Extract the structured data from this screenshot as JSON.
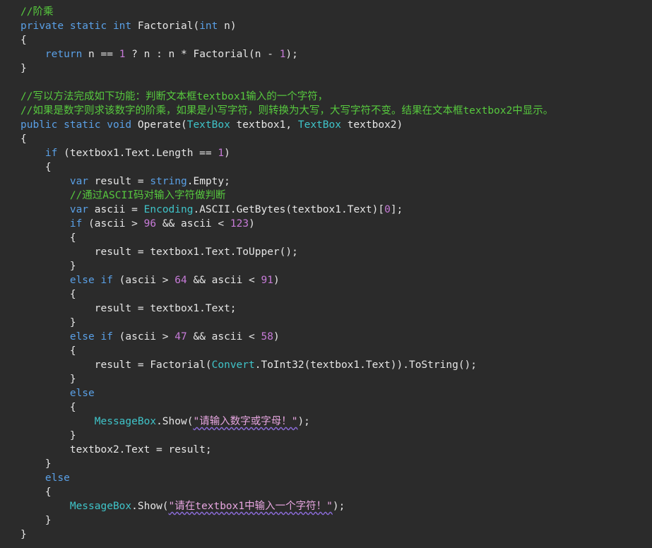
{
  "editor": {
    "background": "#2b2b2b",
    "colors": {
      "keyword": "#5aa0e6",
      "plain": "#e6e6e6",
      "comment": "#57c93e",
      "number": "#c77bd8",
      "type": "#3fc4c9",
      "string": "#e7a6e0"
    },
    "lines": [
      [
        [
          "cm",
          "//阶乘"
        ]
      ],
      [
        [
          "kw",
          "private static int "
        ],
        [
          "pl",
          "Factorial("
        ],
        [
          "kw",
          "int"
        ],
        [
          "pl",
          " n)"
        ]
      ],
      [
        [
          "pl",
          "{"
        ]
      ],
      [
        [
          "pl",
          "    "
        ],
        [
          "kw",
          "return"
        ],
        [
          "pl",
          " n == "
        ],
        [
          "num",
          "1"
        ],
        [
          "pl",
          " ? n : n * Factorial(n - "
        ],
        [
          "num",
          "1"
        ],
        [
          "pl",
          ");"
        ]
      ],
      [
        [
          "pl",
          "}"
        ]
      ],
      [],
      [
        [
          "cm",
          "//写以方法完成如下功能：判断文本框textbox1输入的一个字符，"
        ]
      ],
      [
        [
          "cm",
          "//如果是数字则求该数字的阶乘，如果是小写字符，则转换为大写，大写字符不变。结果在文本框textbox2中显示。"
        ]
      ],
      [
        [
          "kw",
          "public static void "
        ],
        [
          "pl",
          "Operate("
        ],
        [
          "ty",
          "TextBox"
        ],
        [
          "pl",
          " textbox1, "
        ],
        [
          "ty",
          "TextBox"
        ],
        [
          "pl",
          " textbox2)"
        ]
      ],
      [
        [
          "pl",
          "{"
        ]
      ],
      [
        [
          "pl",
          "    "
        ],
        [
          "kw",
          "if"
        ],
        [
          "pl",
          " (textbox1.Text.Length == "
        ],
        [
          "num",
          "1"
        ],
        [
          "pl",
          ")"
        ]
      ],
      [
        [
          "pl",
          "    {"
        ]
      ],
      [
        [
          "pl",
          "        "
        ],
        [
          "kw",
          "var"
        ],
        [
          "pl",
          " result = "
        ],
        [
          "kw",
          "string"
        ],
        [
          "pl",
          ".Empty;"
        ]
      ],
      [
        [
          "pl",
          "        "
        ],
        [
          "cm",
          "//通过ASCII码对输入字符做判断"
        ]
      ],
      [
        [
          "pl",
          "        "
        ],
        [
          "kw",
          "var"
        ],
        [
          "pl",
          " ascii = "
        ],
        [
          "ty",
          "Encoding"
        ],
        [
          "pl",
          ".ASCII.GetBytes(textbox1.Text)["
        ],
        [
          "num",
          "0"
        ],
        [
          "pl",
          "];"
        ]
      ],
      [
        [
          "pl",
          "        "
        ],
        [
          "kw",
          "if"
        ],
        [
          "pl",
          " (ascii > "
        ],
        [
          "num",
          "96"
        ],
        [
          "pl",
          " && ascii < "
        ],
        [
          "num",
          "123"
        ],
        [
          "pl",
          ")"
        ]
      ],
      [
        [
          "pl",
          "        {"
        ]
      ],
      [
        [
          "pl",
          "            result = textbox1.Text.ToUpper();"
        ]
      ],
      [
        [
          "pl",
          "        }"
        ]
      ],
      [
        [
          "pl",
          "        "
        ],
        [
          "kw",
          "else if"
        ],
        [
          "pl",
          " (ascii > "
        ],
        [
          "num",
          "64"
        ],
        [
          "pl",
          " && ascii < "
        ],
        [
          "num",
          "91"
        ],
        [
          "pl",
          ")"
        ]
      ],
      [
        [
          "pl",
          "        {"
        ]
      ],
      [
        [
          "pl",
          "            result = textbox1.Text;"
        ]
      ],
      [
        [
          "pl",
          "        }"
        ]
      ],
      [
        [
          "pl",
          "        "
        ],
        [
          "kw",
          "else if"
        ],
        [
          "pl",
          " (ascii > "
        ],
        [
          "num",
          "47"
        ],
        [
          "pl",
          " && ascii < "
        ],
        [
          "num",
          "58"
        ],
        [
          "pl",
          ")"
        ]
      ],
      [
        [
          "pl",
          "        {"
        ]
      ],
      [
        [
          "pl",
          "            result = Factorial("
        ],
        [
          "ty",
          "Convert"
        ],
        [
          "pl",
          ".ToInt32(textbox1.Text)).ToString();"
        ]
      ],
      [
        [
          "pl",
          "        }"
        ]
      ],
      [
        [
          "pl",
          "        "
        ],
        [
          "kw",
          "else"
        ]
      ],
      [
        [
          "pl",
          "        {"
        ]
      ],
      [
        [
          "pl",
          "            "
        ],
        [
          "ty",
          "MessageBox"
        ],
        [
          "pl",
          ".Show("
        ],
        [
          "str",
          "\"请输入数字或字母！\""
        ],
        [
          "pl",
          ");"
        ]
      ],
      [
        [
          "pl",
          "        }"
        ]
      ],
      [
        [
          "pl",
          "        textbox2.Text = result;"
        ]
      ],
      [
        [
          "pl",
          "    }"
        ]
      ],
      [
        [
          "pl",
          "    "
        ],
        [
          "kw",
          "else"
        ]
      ],
      [
        [
          "pl",
          "    {"
        ]
      ],
      [
        [
          "pl",
          "        "
        ],
        [
          "ty",
          "MessageBox"
        ],
        [
          "pl",
          ".Show("
        ],
        [
          "str",
          "\"请在textbox1中输入一个字符！\""
        ],
        [
          "pl",
          ");"
        ]
      ],
      [
        [
          "pl",
          "    }"
        ]
      ],
      [
        [
          "pl",
          "}"
        ]
      ]
    ]
  }
}
